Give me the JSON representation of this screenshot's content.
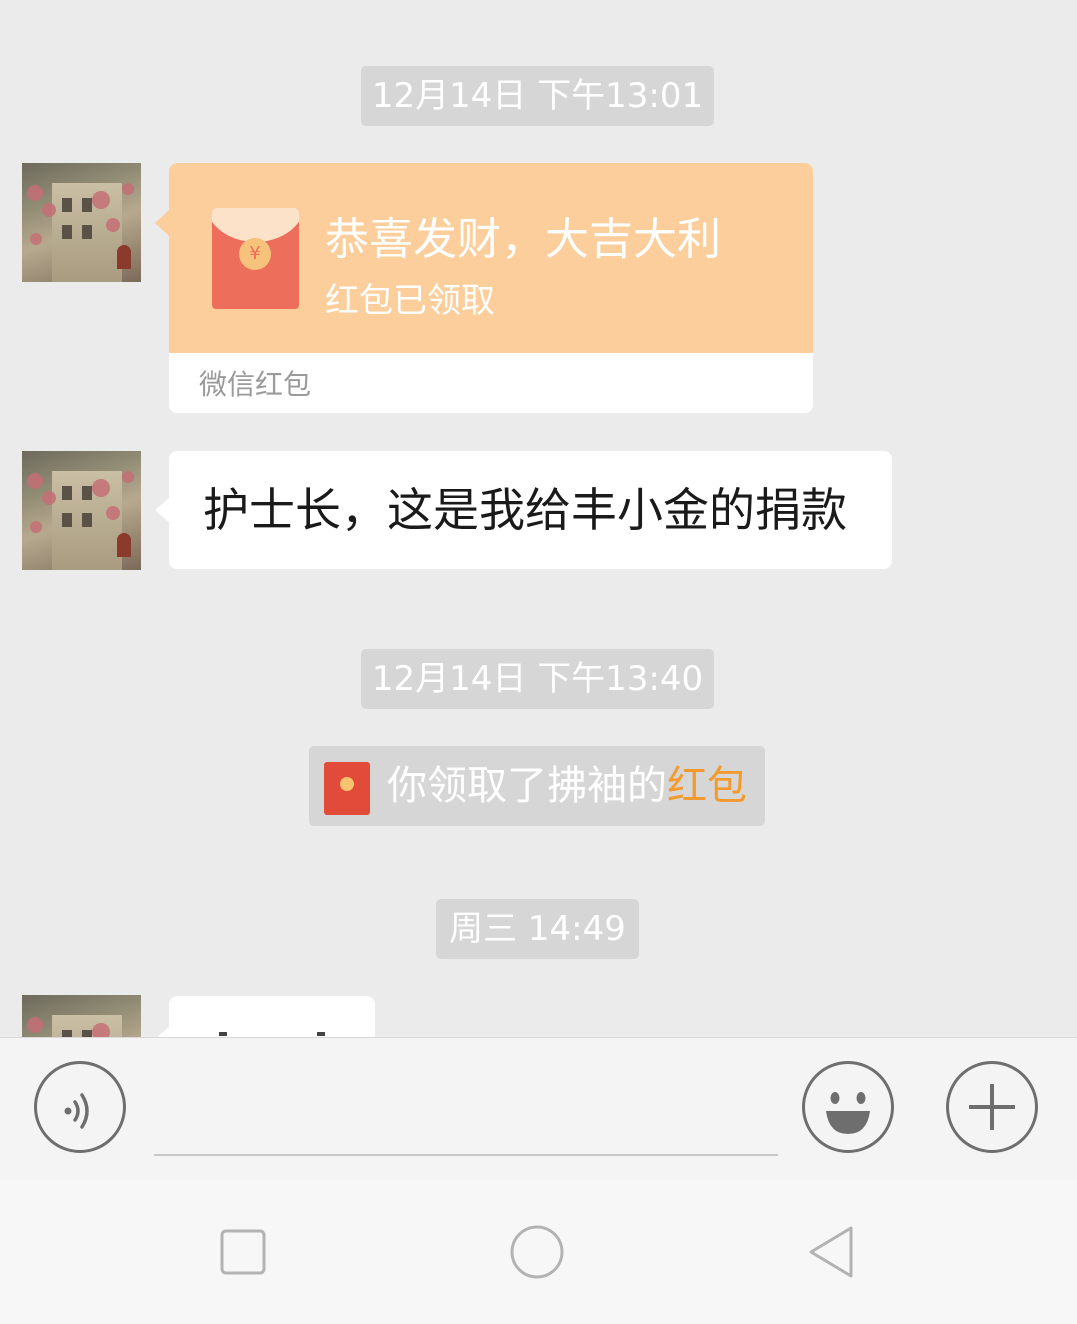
{
  "timestamps": {
    "first": "12月14日 下午13:01",
    "second": "12月14日 下午13:40",
    "third": "周三 14:49"
  },
  "red_packet": {
    "title": "恭喜发财，大吉大利",
    "status": "红包已领取",
    "footer": "微信红包",
    "coin_symbol": "¥",
    "color_top": "#fcce9b",
    "color_envelope": "#ed6e5a"
  },
  "text_message": {
    "text": "护士长，这是我给丰小金的捐款"
  },
  "system_notice": {
    "prefix": "你领取了拂袖的",
    "link": "红包",
    "link_color": "#f39a2e"
  },
  "input_bar": {
    "voice_icon": "voice-icon",
    "emoji_icon": "emoji-icon",
    "plus_icon": "plus-icon",
    "input_value": ""
  },
  "nav_bar": {
    "recent_icon": "square-icon",
    "home_icon": "circle-icon",
    "back_icon": "triangle-back-icon"
  }
}
